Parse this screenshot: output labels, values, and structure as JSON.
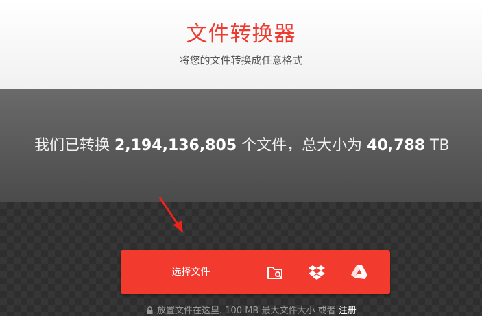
{
  "header": {
    "title": "文件转换器",
    "subtitle": "将您的文件转换成任意格式"
  },
  "stats": {
    "prefix": "我们已转换 ",
    "files_count": "2,194,136,805",
    "middle": " 个文件，总大小为 ",
    "total_size": "40,788",
    "unit": " TB"
  },
  "upload": {
    "choose_label": "选择文件",
    "sources": [
      "folder-search-icon",
      "dropbox-icon",
      "google-drive-icon"
    ],
    "note_text": "放置文件在这里. 100 MB 最大文件大小 或者 ",
    "register_label": "注册"
  },
  "colors": {
    "accent": "#f23a2f",
    "title": "#ee3b32",
    "stats_bg": "#5a5a5a"
  }
}
